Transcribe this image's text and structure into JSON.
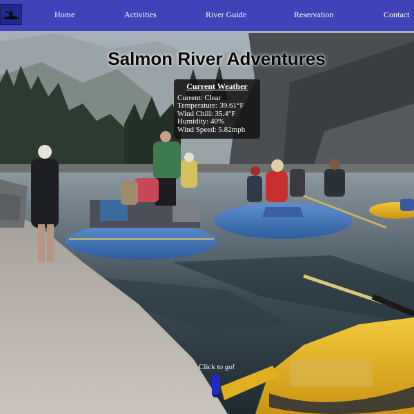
{
  "nav": {
    "logo_icon": "kayak-icon",
    "items": [
      {
        "label": "Home"
      },
      {
        "label": "Activities"
      },
      {
        "label": "River Guide"
      },
      {
        "label": "Reservation"
      },
      {
        "label": "Contact"
      }
    ]
  },
  "hero": {
    "title": "Salmon River Adventures"
  },
  "weather": {
    "title": "Current Weather",
    "current": "Current: Clear",
    "temperature": "Temperature: 39.61°F",
    "wind_chill": "Wind Chill: 35.4°F",
    "humidity": "Humidity: 40%",
    "wind_speed": "Wind Speed: 5.82mph"
  },
  "cta": {
    "label": "Click to go!"
  },
  "colors": {
    "nav_background": "#4043b8",
    "logo_background": "#1f2a8a",
    "button": "#2028c8",
    "raft_blue": "#3f72b8",
    "raft_yellow": "#e8b820"
  }
}
